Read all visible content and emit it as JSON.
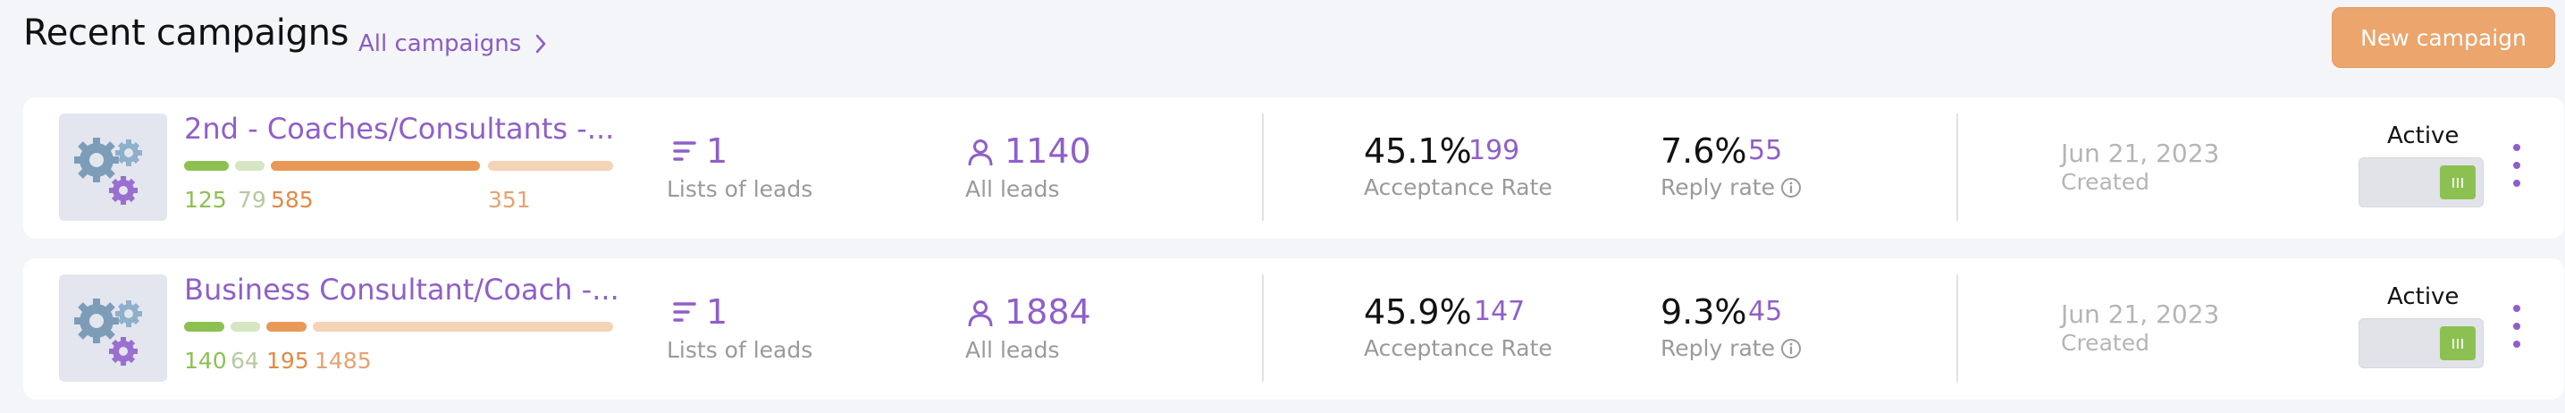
{
  "header": {
    "title": "Recent campaigns",
    "all_link": "All campaigns",
    "new_button": "New campaign"
  },
  "colors": {
    "accent_purple": "#8f5fc9",
    "button_orange": "#eba56d",
    "toggle_green": "#8cc152"
  },
  "icons": {
    "thumbnail": "gears-icon",
    "lists": "list-lines-icon",
    "leads": "person-icon",
    "info": "info-icon",
    "link_arrow": "chevron-right-icon",
    "menu": "kebab-menu-icon"
  },
  "campaigns": [
    {
      "name": "2nd - Coaches/Consultants -...",
      "bars": {
        "green": "125",
        "light_green": "79",
        "orange": "585",
        "light_orange": "351"
      },
      "lists_value": "1",
      "lists_label": "Lists of leads",
      "leads_value": "1140",
      "leads_label": "All leads",
      "acceptance_pct": "45.1%",
      "acceptance_count": "199",
      "acceptance_label": "Acceptance Rate",
      "reply_pct": "7.6%",
      "reply_count": "55",
      "reply_label": "Reply rate",
      "date": "Jun 21, 2023",
      "date_label": "Created",
      "status": "Active",
      "active": true
    },
    {
      "name": "Business Consultant/Coach -...",
      "bars": {
        "green": "140",
        "light_green": "64",
        "orange": "195",
        "light_orange": "1485"
      },
      "lists_value": "1",
      "lists_label": "Lists of leads",
      "leads_value": "1884",
      "leads_label": "All leads",
      "acceptance_pct": "45.9%",
      "acceptance_count": "147",
      "acceptance_label": "Acceptance Rate",
      "reply_pct": "9.3%",
      "reply_count": "45",
      "reply_label": "Reply rate",
      "date": "Jun 21, 2023",
      "date_label": "Created",
      "status": "Active",
      "active": true
    }
  ]
}
